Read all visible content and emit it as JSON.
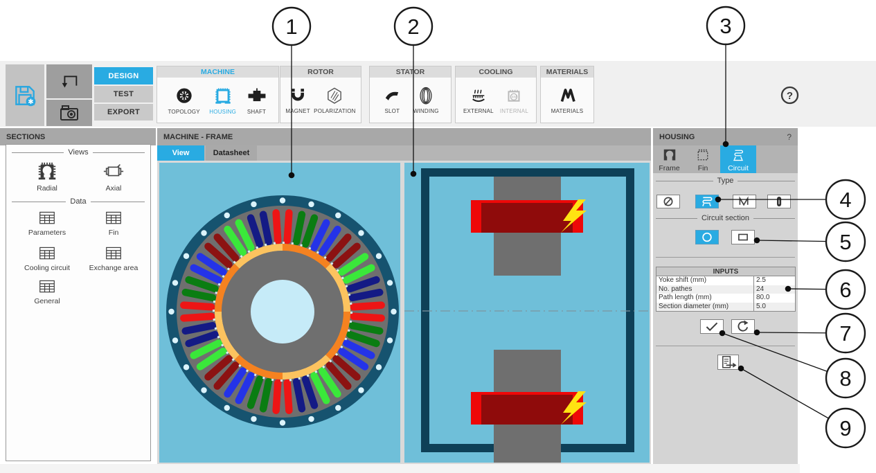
{
  "callouts": {
    "labels": [
      "1",
      "2",
      "3",
      "4",
      "5",
      "6",
      "7",
      "8",
      "9"
    ]
  },
  "toolbar": {
    "design_label": "DESIGN",
    "test_label": "TEST",
    "export_label": "EXPORT",
    "help_label": "?",
    "groups": [
      {
        "title": "MACHINE",
        "items": [
          {
            "label": "TOPOLOGY"
          },
          {
            "label": "HOUSING"
          },
          {
            "label": "SHAFT"
          }
        ]
      },
      {
        "title": "ROTOR",
        "items": [
          {
            "label": "MAGNET"
          },
          {
            "label": "POLARIZATION"
          }
        ]
      },
      {
        "title": "STATOR",
        "items": [
          {
            "label": "SLOT"
          },
          {
            "label": "WINDING"
          }
        ]
      },
      {
        "title": "COOLING",
        "items": [
          {
            "label": "EXTERNAL"
          },
          {
            "label": "INTERNAL"
          }
        ]
      },
      {
        "title": "MATERIALS",
        "items": [
          {
            "label": "MATERIALS"
          }
        ]
      }
    ]
  },
  "sections": {
    "title": "SECTIONS",
    "views_label": "Views",
    "data_label": "Data",
    "radial_label": "Radial",
    "axial_label": "Axial",
    "parameters_label": "Parameters",
    "fin_label": "Fin",
    "cooling_circuit_label": "Cooling circuit",
    "exchange_area_label": "Exchange area",
    "general_label": "General"
  },
  "main": {
    "title": "MACHINE - FRAME",
    "view_tab": "View",
    "datasheet_tab": "Datasheet"
  },
  "housing": {
    "title": "HOUSING",
    "help_label": "?",
    "frame_tab": "Frame",
    "fin_tab": "Fin",
    "circuit_tab": "Circuit",
    "type_label": "Type",
    "circuit_section_label": "Circuit section",
    "inputs": {
      "title": "INPUTS",
      "rows": [
        {
          "label": "Yoke shift (mm)",
          "value": "2.5"
        },
        {
          "label": "No. pathes",
          "value": "24"
        },
        {
          "label": "Path length (mm)",
          "value": "80.0"
        },
        {
          "label": "Section diameter (mm)",
          "value": "5.0"
        }
      ]
    }
  },
  "diagram": {
    "radial": {
      "background": "#6fbfd9",
      "housing_color": "#16536f",
      "iron_color": "#6f6f6f",
      "shaft_color": "#c6ebf8",
      "cooling_dot_color": "#dbf3fb",
      "cooling_path_count": 24,
      "slot_count": 48,
      "slot_palette": [
        "#ed1515",
        "#0a7d12",
        "#2433e8",
        "#8c1212",
        "#3ae83a",
        "#141a85"
      ],
      "magnet_segment_count": 8,
      "magnet_colors": [
        "#f58220",
        "#fcc35f"
      ]
    },
    "axial": {
      "background": "#6fbfd9",
      "frame_color": "#0e4057",
      "core_color": "#6f6f6f",
      "winding_end_color": "#ee0808",
      "winding_body_color": "#8f0b0b",
      "bolt_color": "#ffe312",
      "centerline_color": "#7e949e"
    }
  },
  "colors": {
    "accent": "#29abe2"
  }
}
